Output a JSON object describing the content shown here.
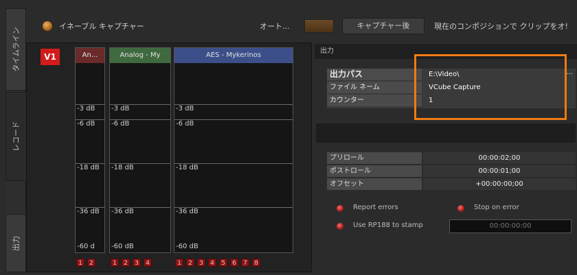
{
  "tabs": [
    {
      "label": "タイムライン"
    },
    {
      "label": "レコード"
    },
    {
      "label": "出力"
    }
  ],
  "topbar": {
    "enable_capture": "イネーブル キャプチャー",
    "auto": "オート...",
    "after_capture": "キャプチャー後",
    "clip_text": "現在のコンポジションで クリップをオ!"
  },
  "meters": {
    "track": "V1",
    "channels": [
      {
        "name": "An...",
        "levels": [
          "-3 dB",
          "-6 dB",
          "-18 dB",
          "-36 dB",
          "-60 d"
        ],
        "buttons": [
          "1",
          "2"
        ]
      },
      {
        "name": "Analog - My",
        "levels": [
          "-3 dB",
          "-6 dB",
          "-18 dB",
          "-36 dB",
          "-60 dB"
        ],
        "buttons": [
          "1",
          "2",
          "3",
          "4"
        ]
      },
      {
        "name": "AES - Mykerinos",
        "levels": [
          "-3 dB",
          "-6 dB",
          "-18 dB",
          "-36 dB",
          "-60 dB"
        ],
        "buttons": [
          "1",
          "2",
          "3",
          "4",
          "5",
          "6",
          "7",
          "8"
        ]
      }
    ]
  },
  "output": {
    "header": "出力",
    "props": [
      {
        "key": "出力パス",
        "value": "E:\\Video\\"
      },
      {
        "key": "ファイル ネーム",
        "value": "VCube Capture"
      },
      {
        "key": "カウンター",
        "value": "1"
      }
    ],
    "browse": "...",
    "timing": [
      {
        "key": "プリロール",
        "value": "00:00:02;00"
      },
      {
        "key": "ポストロール",
        "value": "00:00:01;00"
      },
      {
        "key": "オフセット",
        "value": "+00:00:00;00"
      }
    ],
    "report_errors": "Report errors",
    "stop_on_error": "Stop on error",
    "use_rp188": "Use RP188 to stamp",
    "timecode": "00:00:00:00"
  },
  "colors": {
    "highlight": "#f07a12",
    "track_red": "#d21b1b",
    "chan1": "#6a2a2a",
    "chan2": "#3f6a3f",
    "chan3": "#3c4f8a"
  }
}
